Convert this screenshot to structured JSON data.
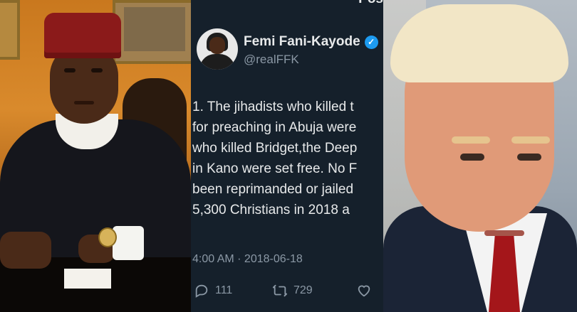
{
  "tweet": {
    "post_label": "Pos",
    "author_name": "Femi Fani-Kayode",
    "handle": "@realFFK",
    "body_lines": [
      "1. The jihadists who killed t",
      "for preaching in Abuja were",
      "who killed Bridget,the Deep",
      "in Kano were set free. No F",
      "been reprimanded or jailed",
      "5,300 Christians in 2018 a"
    ],
    "timestamp": "4:00 AM · 2018-06-18",
    "replies": "111",
    "retweets": "729",
    "icons": {
      "verified": "verified-badge-icon",
      "reply": "reply-icon",
      "retweet": "retweet-icon",
      "like": "heart-icon"
    }
  },
  "colors": {
    "tweet_bg": "#15202b",
    "text": "#e7e9ea",
    "muted": "#8b98a5",
    "verified": "#1d9bf0"
  }
}
